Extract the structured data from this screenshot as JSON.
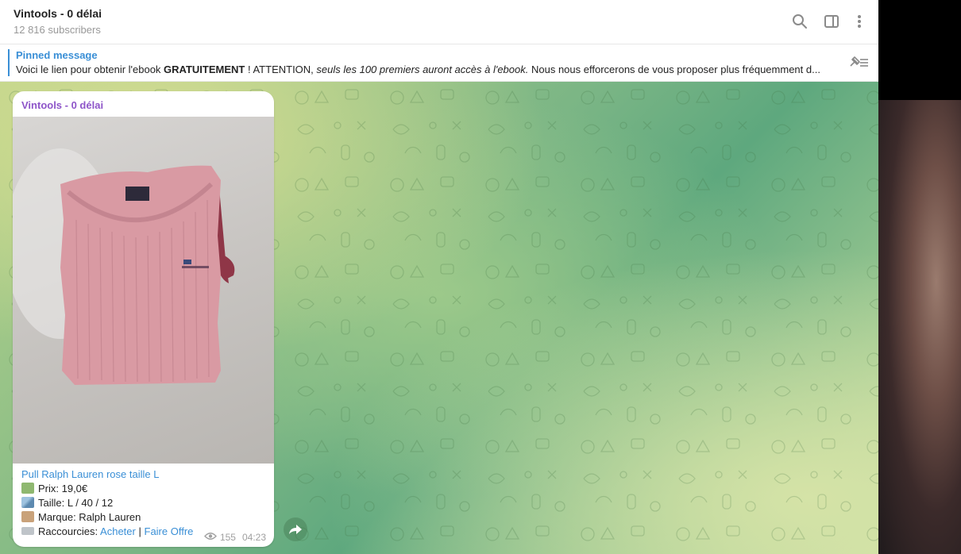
{
  "header": {
    "title": "Vintools - 0 délai",
    "subtitle": "12 816 subscribers",
    "icons": [
      "search-icon",
      "sidebar-toggle-icon",
      "more-vertical-icon"
    ]
  },
  "pinned": {
    "label": "Pinned message",
    "text_part1": "Voici le lien pour obtenir l'ebook ",
    "text_bold": "GRATUITEMENT",
    "text_part2": " ! ATTENTION, ",
    "text_italic": "seuls les 100 premiers auront accès à l'ebook.",
    "text_part3": " Nous nous efforcerons de vous proposer plus fréquemment d..."
  },
  "message": {
    "sender": "Vintools - 0 délai",
    "title": "Pull Ralph Lauren rose taille L",
    "price_label": "Prix: 19,0€",
    "size_label": "Taille: L / 40 / 12",
    "brand_label": "Marque: Ralph Lauren",
    "shortcuts_label": "Raccourcies:",
    "buy_link": "Acheter",
    "separator": "|",
    "offer_link": "Faire Offre",
    "views": "155",
    "time": "04:23"
  },
  "colors": {
    "accent": "#3a8fd6",
    "sender": "#8e55c9",
    "sweater": "#d99aa3"
  }
}
